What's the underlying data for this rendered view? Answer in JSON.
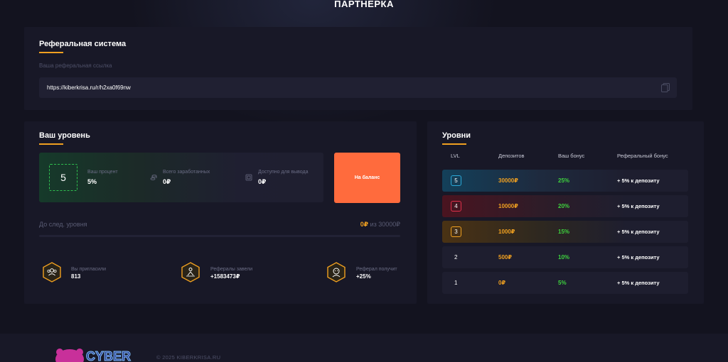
{
  "page": {
    "title": "ПАРТНЕРКА"
  },
  "referral": {
    "title": "Реферальная система",
    "link_label": "Ваша реферальная ссылка",
    "link": "https://kiberkrisa.ru/r/h2xa0f69nw"
  },
  "level": {
    "title": "Ваш уровень",
    "current_level": "5",
    "percent_label": "Ваш процент",
    "percent_value": "5%",
    "earned_label": "Всего заработанных",
    "earned_value": "0₽",
    "withdraw_label": "Доступно для вывода",
    "withdraw_value": "0₽",
    "balance_button": "На баланс",
    "progress_label": "До след. уровня",
    "progress_current": "0₽",
    "progress_sep": "из",
    "progress_target": "30000₽",
    "progress_fraction": 0,
    "invited_label": "Вы пригласили",
    "invited_value": "813",
    "deposited_label": "Рефералы завели",
    "deposited_value": "+1583473₽",
    "referral_gets_label": "Реферал получит",
    "referral_gets_value": "+25%"
  },
  "levels": {
    "title": "Уровни",
    "headers": {
      "lvl": "LVL",
      "deposits": "Депозитов",
      "bonus": "Ваш бонус",
      "ref_bonus": "Реферальный бонус"
    },
    "rows": [
      {
        "lvl": "5",
        "deposit": "30000₽",
        "bonus": "25%",
        "ref_bonus": "+ 5% к депозиту"
      },
      {
        "lvl": "4",
        "deposit": "10000₽",
        "bonus": "20%",
        "ref_bonus": "+ 5% к депозиту"
      },
      {
        "lvl": "3",
        "deposit": "1000₽",
        "bonus": "15%",
        "ref_bonus": "+ 5% к депозиту"
      },
      {
        "lvl": "2",
        "deposit": "500₽",
        "bonus": "10%",
        "ref_bonus": "+ 5% к депозиту"
      },
      {
        "lvl": "1",
        "deposit": "0₽",
        "bonus": "5%",
        "ref_bonus": "+ 5% к депозиту"
      }
    ]
  },
  "footer": {
    "logo_text": "CYBER",
    "copyright": "© 2025 KIBERKRISA.RU"
  },
  "colors": {
    "accent": "#f0a020",
    "button": "#ff6b3d",
    "bonus_green": "#3ed43e",
    "level5": "#2aa8d8",
    "level4": "#e0304a",
    "level3": "#f0a020"
  },
  "icons": [
    "copy-icon",
    "coins-icon",
    "wallet-icon",
    "users-icon",
    "money-users-icon",
    "avatar-icon"
  ]
}
